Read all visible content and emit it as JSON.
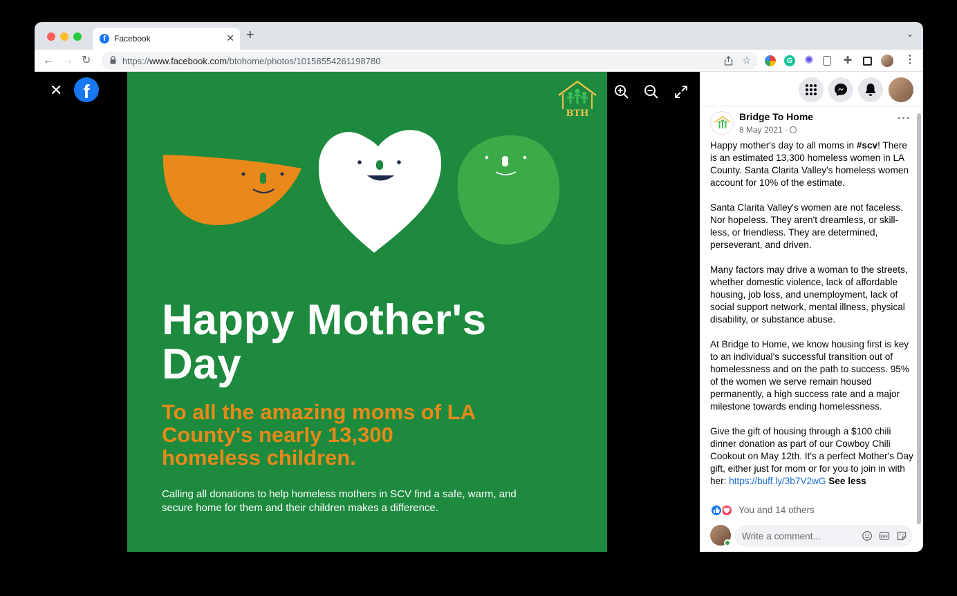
{
  "browser": {
    "tab_title": "Facebook",
    "url_prefix": "https://",
    "url_domain": "www.facebook.com",
    "url_path": "/btohome/photos/10158554261198780"
  },
  "photo": {
    "headline_line1": "Happy Mother's",
    "headline_line2": "Day",
    "subhead": "To all the amazing moms of LA County's nearly 13,300 homeless children.",
    "body": "Calling all donations to help homeless mothers in SCV find a safe, warm, and secure home for them and their children makes a difference.",
    "logo_text": "BTH",
    "colors": {
      "background": "#1d8a3e",
      "orange": "#e8891a",
      "light_green": "#3aab48"
    }
  },
  "post": {
    "page_name": "Bridge To Home",
    "date": "8 May 2021 · ",
    "p1_before": "Happy mother's day to all moms in ",
    "p1_hashtag": "#scv",
    "p1_after": "! There is an estimated 13,300 homeless women in LA County. Santa Clarita Valley's homeless women account for 10% of the estimate.",
    "p2": "Santa Clarita Valley's women are not faceless. Nor hopeless. They aren't dreamless, or skill-less, or friendless. They are determined, perseverant, and driven.",
    "p3": "Many factors may drive a woman to the streets, whether domestic violence, lack of affordable housing, job loss, and unemployment, lack of social support network, mental illness, physical disability, or substance abuse.",
    "p4": "At Bridge to Home, we know housing first is key to an individual's successful transition out of homelessness and on the path to success. 95% of the women we serve remain housed permanently, a high success rate and a major milestone towards ending homelessness.",
    "p5_before": "Give the gift of housing through a $100 chili dinner donation as part of our Cowboy Chili Cookout on May 12th. It's a perfect Mother's Day gift, either just for mom or for you to join in with her: ",
    "p5_link": "https://buff.ly/3b7V2wG",
    "see_less": "See less",
    "reactions_text": "You and 14 others",
    "comment_placeholder": "Write a comment..."
  }
}
